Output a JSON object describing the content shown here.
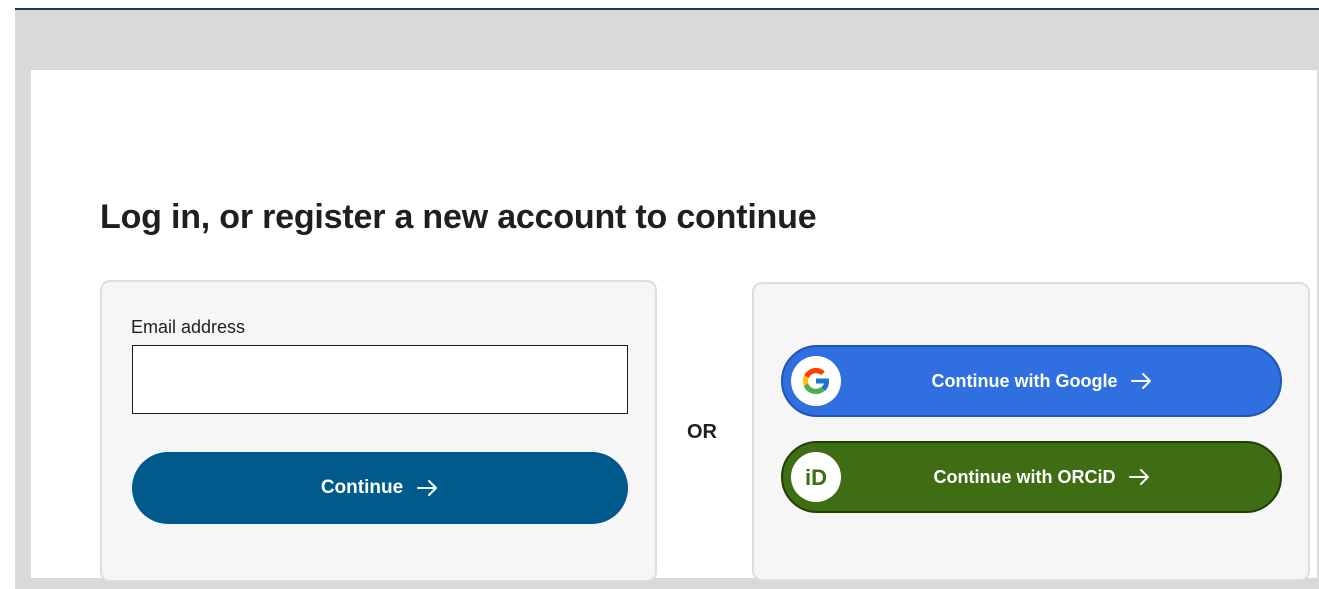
{
  "page": {
    "title": "Log in, or register a new account to continue"
  },
  "email_form": {
    "label": "Email address",
    "value": "",
    "placeholder": "",
    "continue_label": "Continue"
  },
  "separator": {
    "text": "OR"
  },
  "providers": {
    "google": {
      "label": "Continue with Google",
      "icon": "google-icon",
      "color": "#2f6fe0"
    },
    "orcid": {
      "label": "Continue with ORCiD",
      "icon": "orcid-icon",
      "icon_text": "iD",
      "color": "#3f6d13"
    }
  },
  "colors": {
    "primary_button": "#005a8c",
    "top_rule": "#1f3a4f"
  }
}
